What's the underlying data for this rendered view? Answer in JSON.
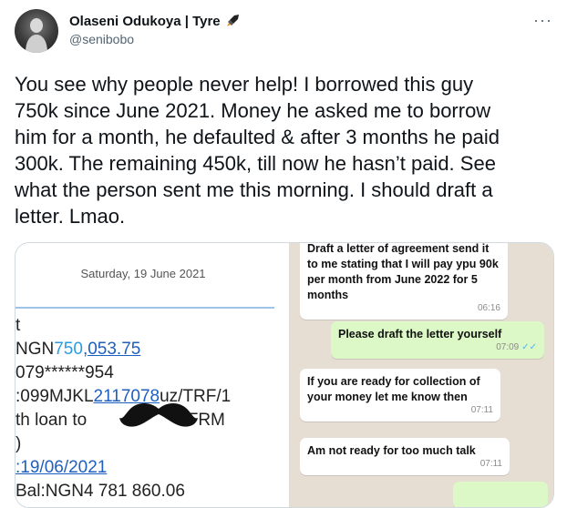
{
  "tweet": {
    "display_name": "Olaseni Odukoya | Tyre",
    "handle": "@senibobo",
    "more_label": "···",
    "text_lines": [
      "You see why people never help! I borrowed this guy",
      "750k since June 2021. Money he asked me to borrow",
      "him for a month, he defaulted & after 3 months he paid",
      "300k. The remaining 450k, till now he hasn’t paid. See",
      "what the person sent me this morning. I should draft a",
      "letter. Lmao."
    ]
  },
  "bank_screenshot": {
    "date": "Saturday, 19 June 2021",
    "rows": {
      "r1": "t",
      "r2_prefix": "NGN",
      "r2_highlight": "750",
      "r2_rest": ",053.75",
      "r3": "079******954",
      "r4_prefix": ":099MJKL",
      "r4_link": "2117078",
      "r4_suffix": "uz/TRF/1",
      "r5_prefix": "th loan to ",
      "r5_suffix": "/FRM",
      "r6": ")",
      "r7": ":19/06/2021",
      "r8": "Bal:NGN4 781 860.06"
    }
  },
  "chat": {
    "messages": [
      {
        "text": "Draft a letter of agreement send it to me stating that I will pay ypu 90k per month from June 2022 for 5 months",
        "time": "06:16"
      },
      {
        "text": "Please draft the letter yourself",
        "time": "07:09"
      },
      {
        "text": "If you are ready for collection of your money let me know then",
        "time": "07:11"
      },
      {
        "text": "Am not ready for too much talk",
        "time": "07:11"
      }
    ]
  },
  "colors": {
    "link_blue": "#1f5fbf",
    "amount_blue": "#2b9be0",
    "chat_bg": "#e6ded3",
    "outgoing_bubble": "#dcf8c6",
    "read_ticks": "#4fb6ec"
  },
  "icons": {
    "rocket": "rocket-icon",
    "more": "more-icon"
  }
}
